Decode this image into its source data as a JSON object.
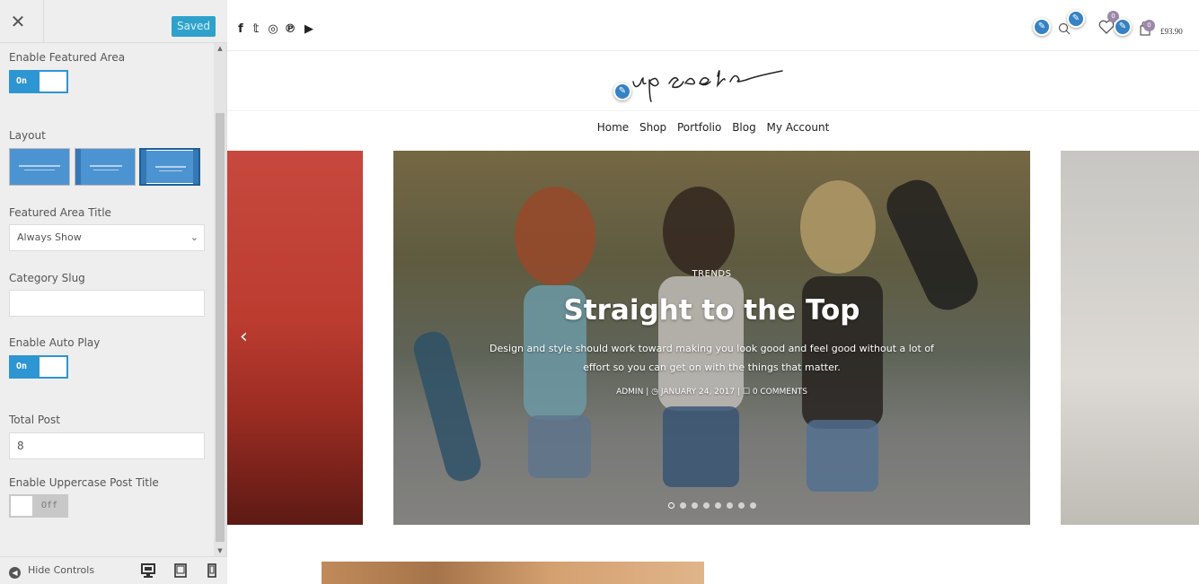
{
  "panel": {
    "header": {
      "close_icon": "close-icon",
      "saved_label": "Saved"
    },
    "controls": {
      "featured_area": {
        "label": "Enable Featured Area",
        "state": "On"
      },
      "layout": {
        "label": "Layout",
        "options": [
          "layout-1",
          "layout-2",
          "layout-3"
        ],
        "selected_index": 2
      },
      "featured_title": {
        "label": "Featured Area Title",
        "value": "Always Show"
      },
      "category_slug": {
        "label": "Category Slug",
        "value": ""
      },
      "auto_play": {
        "label": "Enable Auto Play",
        "state": "On"
      },
      "total_post": {
        "label": "Total Post",
        "value": "8"
      },
      "uppercase_title": {
        "label": "Enable Uppercase Post Title",
        "state": "Off"
      }
    },
    "footer": {
      "hide_controls_label": "Hide Controls",
      "devices": [
        "desktop-icon",
        "tablet-icon",
        "mobile-icon"
      ]
    }
  },
  "site": {
    "social_icons": [
      {
        "name": "facebook-icon",
        "glyph": "f"
      },
      {
        "name": "twitter-icon",
        "glyph": "𝕥"
      },
      {
        "name": "instagram-icon",
        "glyph": "◎"
      },
      {
        "name": "pinterest-icon",
        "glyph": "℗"
      },
      {
        "name": "youtube-icon",
        "glyph": "▶"
      }
    ],
    "header_icons": {
      "wishlist_count": "0",
      "cart_count": "0",
      "cart_total": "£93.90"
    },
    "logo_text": "upscale",
    "nav": [
      "Home",
      "Shop",
      "Portfolio",
      "Blog",
      "My Account"
    ],
    "slide": {
      "category": "TRENDS",
      "title": "Straight to the Top",
      "description": "Design and style should work toward making you look good and feel good without a lot of effort so you can get on with the things that matter.",
      "author": "ADMIN",
      "date": "JANUARY 24, 2017",
      "comments": "0 COMMENTS",
      "dot_count": 8,
      "active_dot": 0
    }
  },
  "colors": {
    "accent": "#2e95d3",
    "saved_button": "#2ea2cc",
    "edit_shortcut": "#3582c4",
    "badge": "#9c88a8"
  }
}
